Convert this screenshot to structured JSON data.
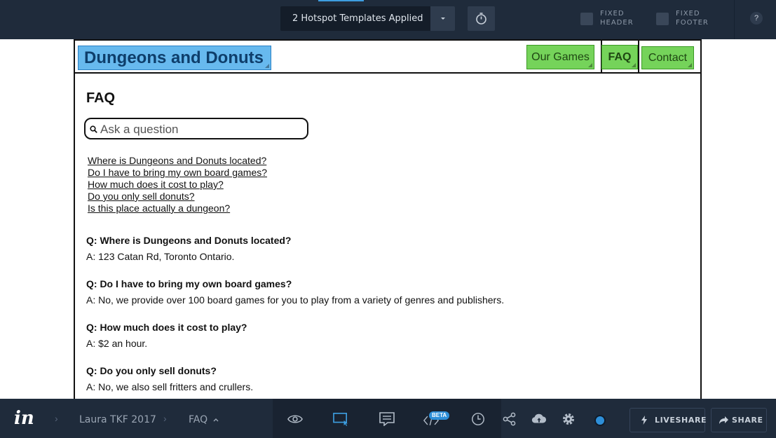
{
  "topbar": {
    "templates_label": "2 Hotspot Templates Applied",
    "fixed_header_label_1": "FIXED",
    "fixed_header_label_2": "HEADER",
    "fixed_footer_label_1": "FIXED",
    "fixed_footer_label_2": "FOOTER",
    "help_label": "?"
  },
  "mockup": {
    "logo_text": "Dungeons and Donuts",
    "nav": [
      "Our Games",
      "FAQ",
      "Contact"
    ],
    "page_title": "FAQ",
    "search_placeholder": "Ask a question",
    "question_links": [
      "Where is Dungeons and Donuts located?",
      "Do I have to bring my own board games?",
      "How much does it cost to play?",
      "Do you only sell donuts?",
      "Is this place actually a dungeon?"
    ],
    "qa": [
      {
        "q": "Q: Where is Dungeons and Donuts located?",
        "a": "A: 123 Catan Rd, Toronto Ontario."
      },
      {
        "q": "Q: Do I have to bring my own board games?",
        "a": "A: No, we provide over 100 board games for you to play from a variety of genres and publishers."
      },
      {
        "q": "Q: How much does it cost to play?",
        "a": "A: $2 an hour."
      },
      {
        "q": "Q: Do you only sell donuts?",
        "a": "A: No, we also sell fritters and crullers."
      }
    ]
  },
  "bottombar": {
    "brand": "in",
    "project": "Laura TKF 2017",
    "screen": "FAQ",
    "beta_badge": "BETA",
    "liveshare_label": "LIVESHARE",
    "share_label": "SHARE"
  },
  "colors": {
    "chrome": "#1f2b3b",
    "hotspot_green": "#75d35a",
    "logo_blue": "#67b9ee",
    "accent": "#2e8fd8"
  }
}
